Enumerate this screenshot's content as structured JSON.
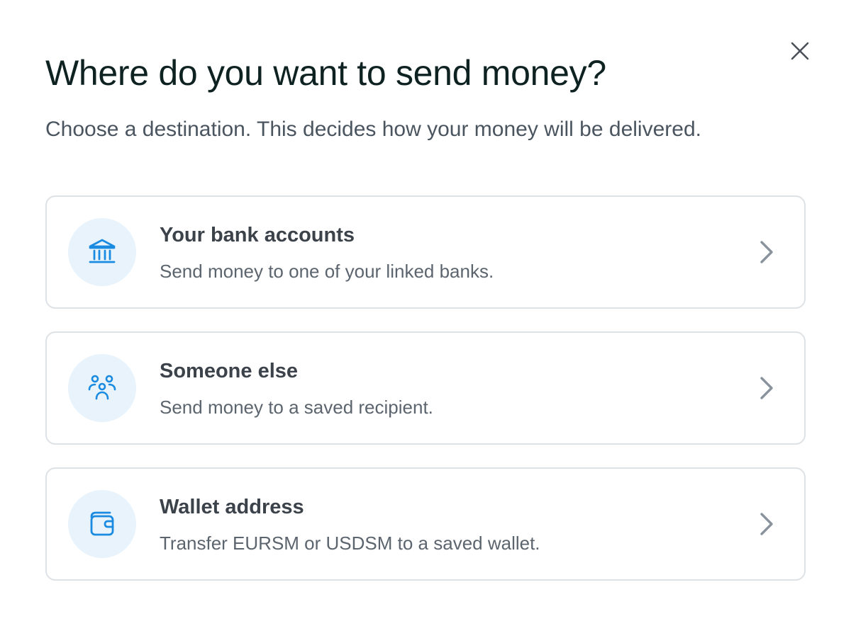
{
  "modal": {
    "title": "Where do you want to send money?",
    "subtitle": "Choose a destination. This decides how your money will be delivered.",
    "close_icon": "close-icon"
  },
  "options": [
    {
      "title": "Your bank accounts",
      "description": "Send money to one of your linked banks.",
      "icon": "bank-icon"
    },
    {
      "title": "Someone else",
      "description": "Send money to a saved recipient.",
      "icon": "people-icon"
    },
    {
      "title": "Wallet address",
      "description": "Transfer EURSM or USDSM to a saved wallet.",
      "icon": "wallet-icon"
    }
  ],
  "colors": {
    "accent": "#1a8be0",
    "icon_bg": "#e8f3fc",
    "border": "#dde2e6",
    "title": "#0f2222",
    "chevron": "#8a939c"
  }
}
